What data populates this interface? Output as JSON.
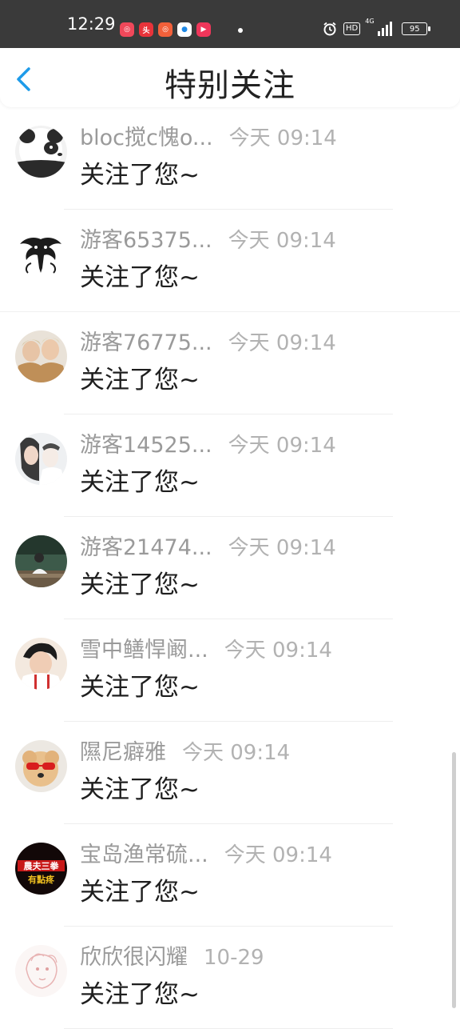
{
  "status_bar": {
    "time": "12:29",
    "app_icons": [
      "xiaohongshu-icon",
      "toutiao-icon",
      "xiaohongshu-icon",
      "app-blue-icon",
      "video-icon"
    ],
    "hd": "HD",
    "network": "4G",
    "battery": "95"
  },
  "header": {
    "back_icon": "chevron-left-icon",
    "title": "特别关注"
  },
  "items": [
    {
      "name": "bloc搅c愧o...",
      "time": "今天 09:14",
      "message": "关注了您~"
    },
    {
      "name": "游客65375...",
      "time": "今天 09:14",
      "message": "关注了您~"
    },
    {
      "name": "游客76775...",
      "time": "今天 09:14",
      "message": "关注了您~"
    },
    {
      "name": "游客14525...",
      "time": "今天 09:14",
      "message": "关注了您~"
    },
    {
      "name": "游客21474...",
      "time": "今天 09:14",
      "message": "关注了您~"
    },
    {
      "name": "雪中鳝悍阚...",
      "time": "今天 09:14",
      "message": "关注了您~"
    },
    {
      "name": "隰尼癖雅",
      "time": "今天 09:14",
      "message": "关注了您~"
    },
    {
      "name": "宝岛渔常硫...",
      "time": "今天 09:14",
      "message": "关注了您~"
    },
    {
      "name": "欣欣很闪耀",
      "time": "10-29",
      "message": "关注了您~"
    }
  ],
  "avatar_texts": {
    "line1": "農夫三拳",
    "line2": "有點疼"
  },
  "colors": {
    "status_bar_bg": "#3a3a3a",
    "accent_blue": "#1e9be9",
    "name_gray": "#9a9a9a",
    "time_gray": "#b2b2b2",
    "message_black": "#1e1e1e"
  }
}
